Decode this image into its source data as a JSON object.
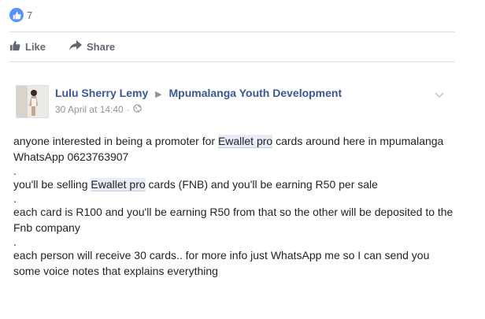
{
  "reactions": {
    "count": "7"
  },
  "actions": {
    "like_label": "Like",
    "share_label": "Share"
  },
  "post": {
    "author": "Lulu Sherry Lemy",
    "group": "Mpumalanga Youth Development",
    "timestamp": "30 April at 14:40",
    "timestamp_separator": "·",
    "paragraphs": [
      {
        "before": "anyone interested in being a promoter for ",
        "highlight": "Ewallet pro",
        "after": " cards around here in mpumalanga WhatsApp 0623763907"
      },
      {
        "before": "you'll be selling ",
        "highlight": "Ewallet pro",
        "after": " cards (FNB) and you'll be earning R50 per sale"
      },
      {
        "before": "each card is R100 and you'll be earning R50 from that so the other will be deposited to the Fnb company",
        "highlight": "",
        "after": ""
      },
      {
        "before": "each person will receive 30 cards.. for more info just WhatsApp me so I can send you some voice notes that explains everything",
        "highlight": "",
        "after": ""
      }
    ],
    "dot_separator": "."
  },
  "colors": {
    "accent": "#385898",
    "like_blue": "#5890ff",
    "muted": "#606770",
    "meta": "#90949c"
  },
  "icons": {
    "reaction": "thumbs-up-icon",
    "like": "thumbs-up-icon",
    "share": "share-arrow-icon",
    "privacy": "globe-icon",
    "menu": "chevron-down-icon"
  }
}
